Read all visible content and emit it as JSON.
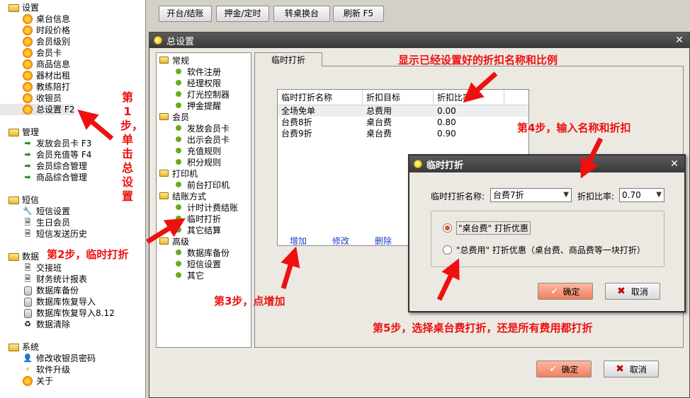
{
  "left_tree": {
    "sections": [
      {
        "label": "设置",
        "items": [
          "桌台信息",
          "时段价格",
          "会员级别",
          "会员卡",
          "商品信息",
          "器材出租",
          "教练陪打",
          "收银员",
          "总设置 F2"
        ]
      },
      {
        "label": "管理",
        "items": [
          "发放会员卡 F3",
          "会员充值等 F4",
          "会员综合管理",
          "商品综合管理"
        ]
      },
      {
        "label": "短信",
        "items": [
          "短信设置",
          "生日会员",
          "短信发送历史"
        ]
      },
      {
        "label": "数据",
        "items": [
          "交接班",
          "财务统计报表",
          "数据库备份",
          "数据库恢复导入",
          "数据库恢复导入8.12",
          "数据清除"
        ]
      },
      {
        "label": "系统",
        "items": [
          "修改收银员密码",
          "软件升级",
          "关于"
        ]
      }
    ]
  },
  "toolbar": {
    "open_checkout": "开台/结账",
    "deposit_timer": "押金/定时",
    "switch_table": "转桌换台",
    "refresh": "刷新 F5"
  },
  "main_window": {
    "title": "总设置",
    "tree": [
      {
        "label": "常规",
        "items": [
          "软件注册",
          "经理权限",
          "灯光控制器",
          "押金提醒"
        ]
      },
      {
        "label": "会员",
        "items": [
          "发放会员卡",
          "出示会员卡",
          "充值规则",
          "积分规则"
        ]
      },
      {
        "label": "打印机",
        "items": [
          "前台打印机"
        ]
      },
      {
        "label": "结账方式",
        "items": [
          "计时计费结账",
          "临时打折",
          "其它结算"
        ]
      },
      {
        "label": "高级",
        "items": [
          "数据库备份",
          "短信设置",
          "其它"
        ]
      }
    ],
    "tab_label": "临时打折",
    "list": {
      "headers": [
        "临时打折名称",
        "折扣目标",
        "折扣比率"
      ],
      "rows": [
        [
          "全场免单",
          "总费用",
          "0.00"
        ],
        [
          "台费8折",
          "桌台费",
          "0.80"
        ],
        [
          "台费9折",
          "桌台费",
          "0.90"
        ]
      ]
    },
    "add_label": "增加",
    "edit_label": "修改",
    "delete_label": "删除",
    "ok_label": "确定",
    "cancel_label": "取消"
  },
  "dialog": {
    "title": "临时打折",
    "name_label": "临时打折名称:",
    "name_value": "台费7折",
    "rate_label": "折扣比率:",
    "rate_value": "0.70",
    "option_table": "\"桌台费\" 打折优惠",
    "option_total": "\"总费用\" 打折优惠（桌台费、商品费等一块打折）",
    "ok_label": "确定",
    "cancel_label": "取消"
  },
  "annotations": {
    "step1": "第1步，单击总设置",
    "step2": "第2步，临时打折",
    "step3": "第3步，点增加",
    "step4": "第4步，输入名称和折扣",
    "step5": "第5步，选择桌台费打折，还是所有费用都打折",
    "top_note": "显示已经设置好的折扣名称和比例"
  },
  "colors": {
    "annotation": "#ee1010",
    "title_bar": "#3a3a3a",
    "ok_button": "#f08060",
    "link": "#1a3cc8"
  }
}
